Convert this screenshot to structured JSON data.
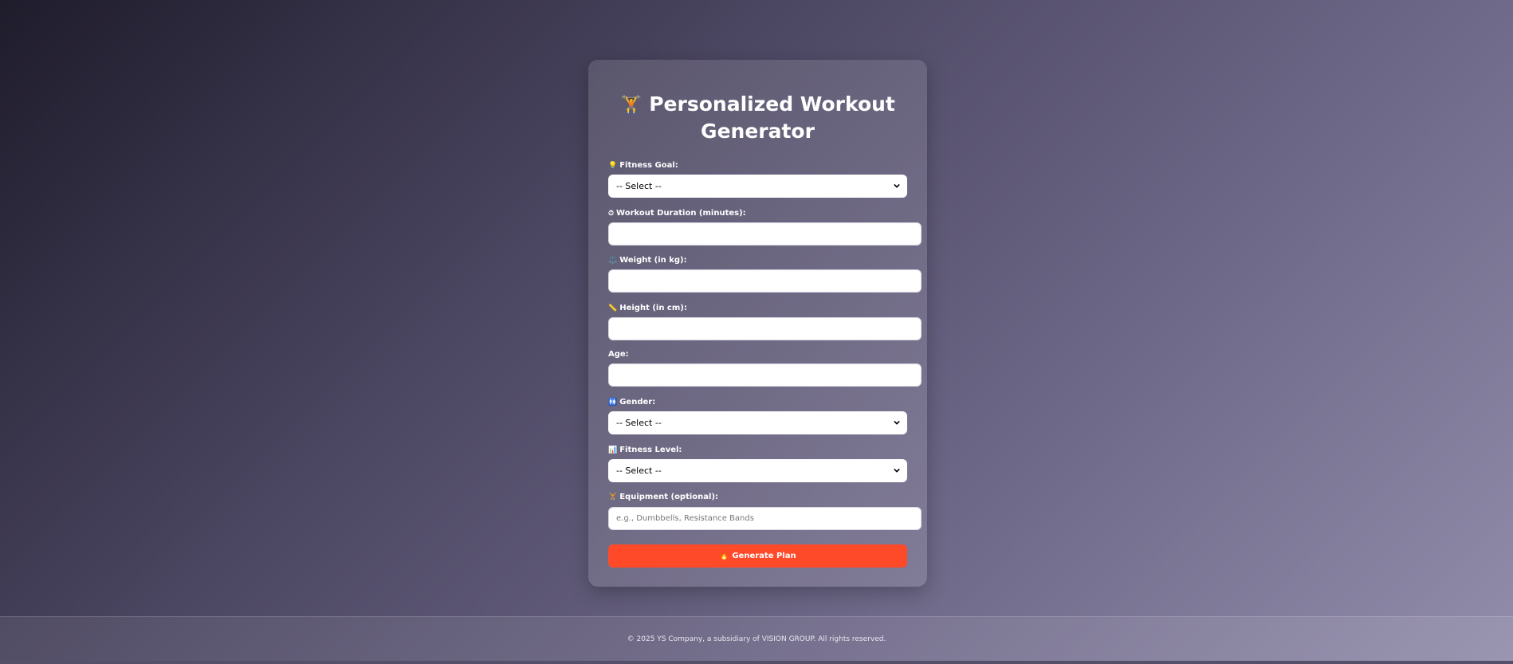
{
  "form": {
    "title_icon": "🏋️",
    "title": "Personalized Workout Generator",
    "fields": [
      {
        "icon": "💡",
        "label": "Fitness Goal:",
        "type": "select",
        "value": "-- Select --"
      },
      {
        "icon": "⏱",
        "label": "Workout Duration (minutes):",
        "type": "input",
        "value": ""
      },
      {
        "icon": "⚖️",
        "label": "Weight (in kg):",
        "type": "input",
        "value": ""
      },
      {
        "icon": "📏",
        "label": "Height (in cm):",
        "type": "input",
        "value": ""
      },
      {
        "icon": "",
        "label": "Age:",
        "type": "input",
        "value": ""
      },
      {
        "icon": "🚻",
        "label": "Gender:",
        "type": "select",
        "value": "-- Select --"
      },
      {
        "icon": "📊",
        "label": "Fitness Level:",
        "type": "select",
        "value": "-- Select --"
      },
      {
        "icon": "🏋",
        "label": "Equipment (optional):",
        "type": "input",
        "value": "",
        "placeholder": "e.g., Dumbbells, Resistance Bands"
      }
    ],
    "button_icon": "🔥",
    "button_label": "Generate Plan"
  },
  "footer": {
    "text": "© 2025 YS Company, a subsidiary of VISION GROUP. All rights reserved."
  }
}
